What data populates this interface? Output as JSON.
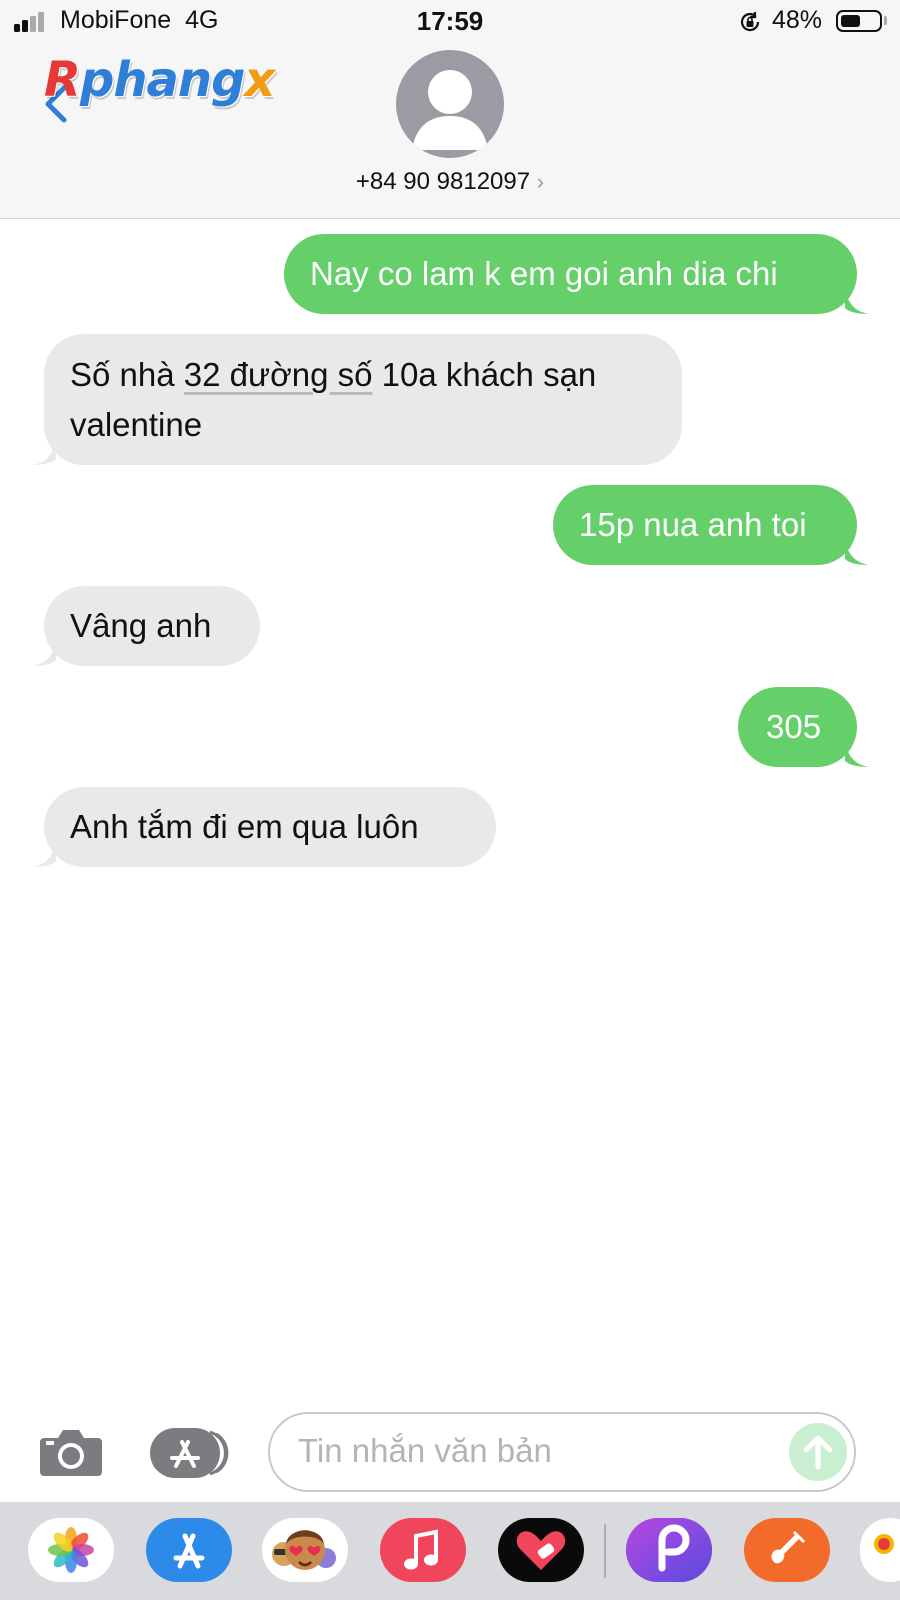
{
  "status_bar": {
    "carrier": "MobiFone",
    "network": "4G",
    "time": "17:59",
    "battery_percent": "48%",
    "battery_level": 0.48
  },
  "header": {
    "logo_text": [
      "R",
      "phang",
      "x"
    ],
    "contact": "+84 90 9812097",
    "chevron": "›"
  },
  "messages": [
    {
      "direction": "outgoing",
      "text": "Nay co lam k em goi anh dia chi"
    },
    {
      "direction": "incoming",
      "text_parts": [
        "Số nhà ",
        "32 đường số",
        " 10a khách sạn",
        "valentine"
      ]
    },
    {
      "direction": "outgoing",
      "text": "15p nua anh toi"
    },
    {
      "direction": "incoming",
      "text": "Vâng anh"
    },
    {
      "direction": "outgoing",
      "text": "305"
    },
    {
      "direction": "incoming",
      "text": "Anh tắm đi em qua luôn"
    }
  ],
  "input": {
    "placeholder": "Tin nhắn văn bản"
  },
  "icons": {
    "camera": "camera-icon",
    "apps": "app-store-icon",
    "send": "arrow-up-icon"
  },
  "dock_apps": [
    "Photos",
    "App Store",
    "Memoji",
    "Music",
    "Fitness",
    "Picsart",
    "GarageBand",
    "Maps"
  ],
  "colors": {
    "outgoing_bubble": "#65d06a",
    "incoming_bubble": "#e9e9eb",
    "accent_blue": "#2f7fd8"
  }
}
